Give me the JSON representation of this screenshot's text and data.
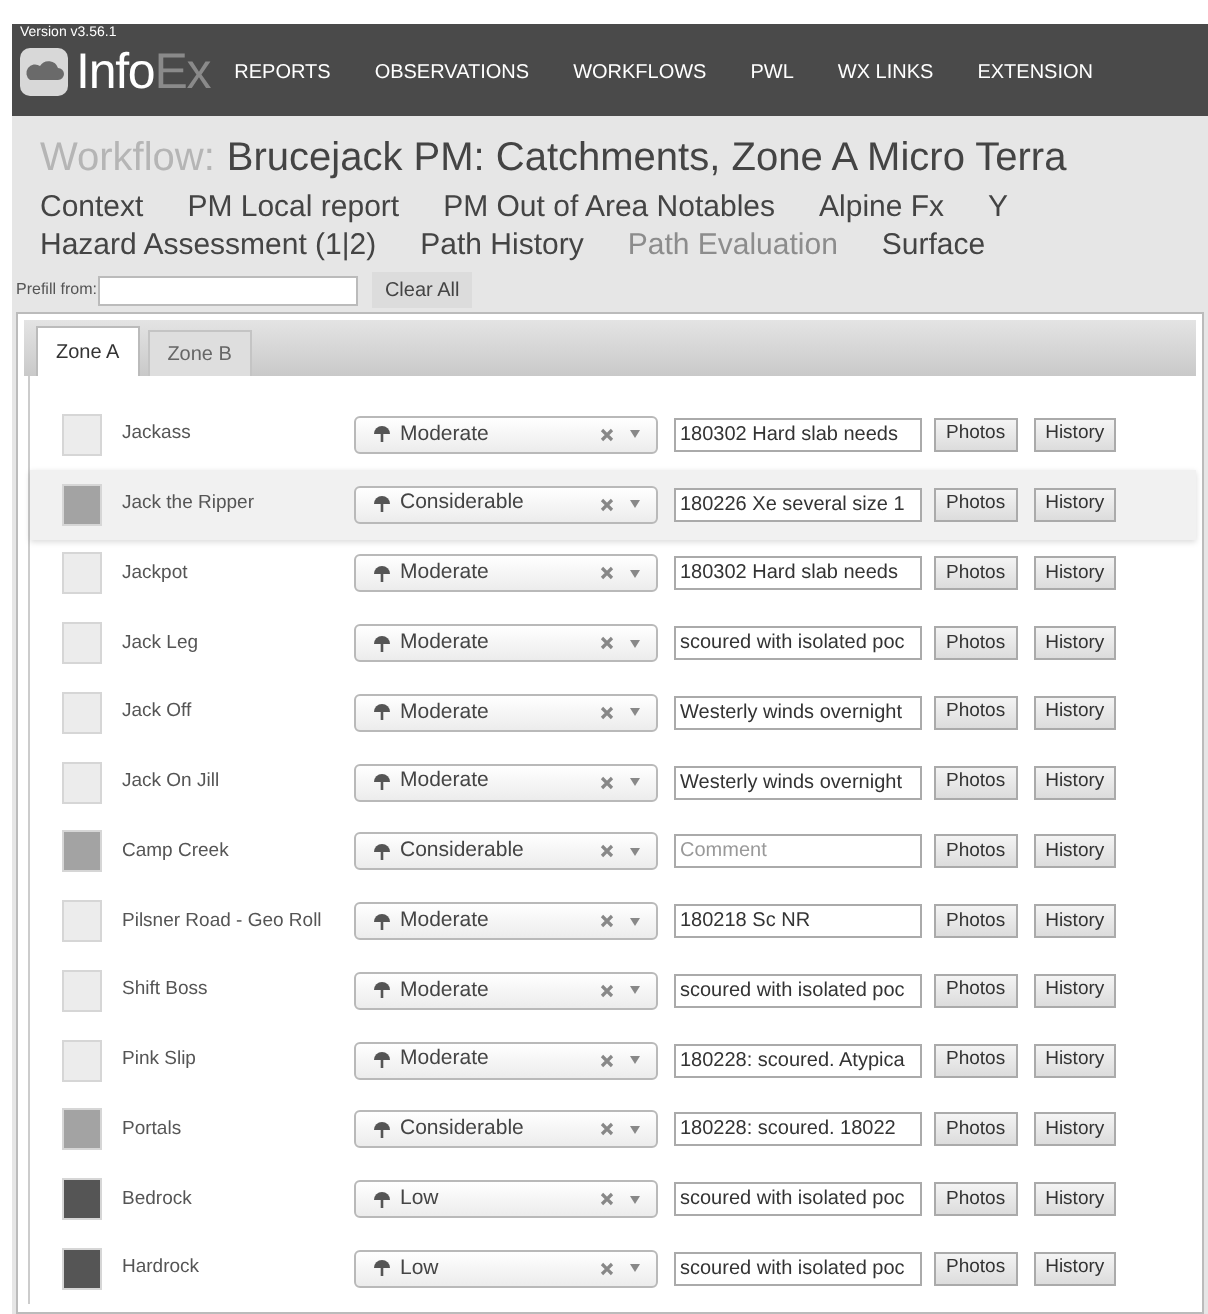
{
  "version": "Version v3.56.1",
  "logo": {
    "text": "Info",
    "accent": "Ex"
  },
  "nav": [
    "REPORTS",
    "OBSERVATIONS",
    "WORKFLOWS",
    "PWL",
    "WX LINKS",
    "EXTENSION"
  ],
  "title": {
    "label": "Workflow:",
    "text": "Brucejack PM: Catchments, Zone A Micro Terra"
  },
  "steps": [
    [
      {
        "label": "Context",
        "selected": false
      },
      {
        "label": "PM Local report",
        "selected": false
      },
      {
        "label": "PM Out of Area Notables",
        "selected": false
      },
      {
        "label": "Alpine Fx",
        "selected": false
      },
      {
        "label": "Y",
        "selected": false
      }
    ],
    [
      {
        "label": "Hazard Assessment (1|2)",
        "selected": false
      },
      {
        "label": "Path History",
        "selected": false
      },
      {
        "label": "Path Evaluation",
        "selected": true
      },
      {
        "label": "Surface",
        "selected": false
      }
    ]
  ],
  "prefill": {
    "label": "Prefill from:",
    "button": "Clear All"
  },
  "tabs": [
    {
      "label": "Zone A",
      "selected": true
    },
    {
      "label": "Zone B",
      "selected": false
    }
  ],
  "rows": [
    {
      "name": "Jackass",
      "color": "#ececec",
      "rating": "Moderate",
      "comment": "180302 Hard slab needs",
      "selected": false,
      "buttons": [
        "Photos",
        "History"
      ]
    },
    {
      "name": "Jack the Ripper",
      "color": "#a3a3a3",
      "rating": "Considerable",
      "comment": "180226 Xe several size 1",
      "selected": true,
      "buttons": [
        "Photos",
        "History"
      ]
    },
    {
      "name": "Jackpot",
      "color": "#ececec",
      "rating": "Moderate",
      "comment": "180302 Hard slab needs",
      "selected": false,
      "buttons": [
        "Photos",
        "History"
      ]
    },
    {
      "name": "Jack Leg",
      "color": "#ececec",
      "rating": "Moderate",
      "comment": "scoured with isolated poc",
      "selected": false,
      "buttons": [
        "Photos",
        "History"
      ]
    },
    {
      "name": "Jack Off",
      "color": "#ececec",
      "rating": "Moderate",
      "comment": "Westerly winds overnight",
      "selected": false,
      "buttons": [
        "Photos",
        "History"
      ]
    },
    {
      "name": "Jack On Jill",
      "color": "#ececec",
      "rating": "Moderate",
      "comment": "Westerly winds overnight",
      "selected": false,
      "buttons": [
        "Photos",
        "History"
      ]
    },
    {
      "name": "Camp Creek",
      "color": "#a3a3a3",
      "rating": "Considerable",
      "placeholder": "Comment",
      "selected": false,
      "buttons": [
        "Photos",
        "History"
      ]
    },
    {
      "name": "Pilsner Road - Geo Roll",
      "color": "#ececec",
      "rating": "Moderate",
      "comment": "180218 Sc NR",
      "selected": false,
      "buttons": [
        "Photos",
        "History"
      ]
    },
    {
      "name": "Shift Boss",
      "color": "#ececec",
      "rating": "Moderate",
      "comment": "scoured with isolated poc",
      "selected": false,
      "buttons": [
        "Photos",
        "History"
      ]
    },
    {
      "name": "Pink Slip",
      "color": "#ececec",
      "rating": "Moderate",
      "comment": "180228: scoured. Atypica",
      "selected": false,
      "buttons": [
        "Photos",
        "History"
      ]
    },
    {
      "name": "Portals",
      "color": "#a3a3a3",
      "rating": "Considerable",
      "comment": "180228: scoured. 18022",
      "selected": false,
      "buttons": [
        "Photos",
        "History"
      ]
    },
    {
      "name": "Bedrock",
      "color": "#555555",
      "rating": "Low",
      "comment": "scoured with isolated poc",
      "selected": false,
      "buttons": [
        "Photos",
        "History"
      ]
    },
    {
      "name": "Hardrock",
      "color": "#555555",
      "rating": "Low",
      "comment": "scoured with isolated poc",
      "selected": false,
      "buttons": [
        "Photos",
        "History"
      ]
    }
  ]
}
